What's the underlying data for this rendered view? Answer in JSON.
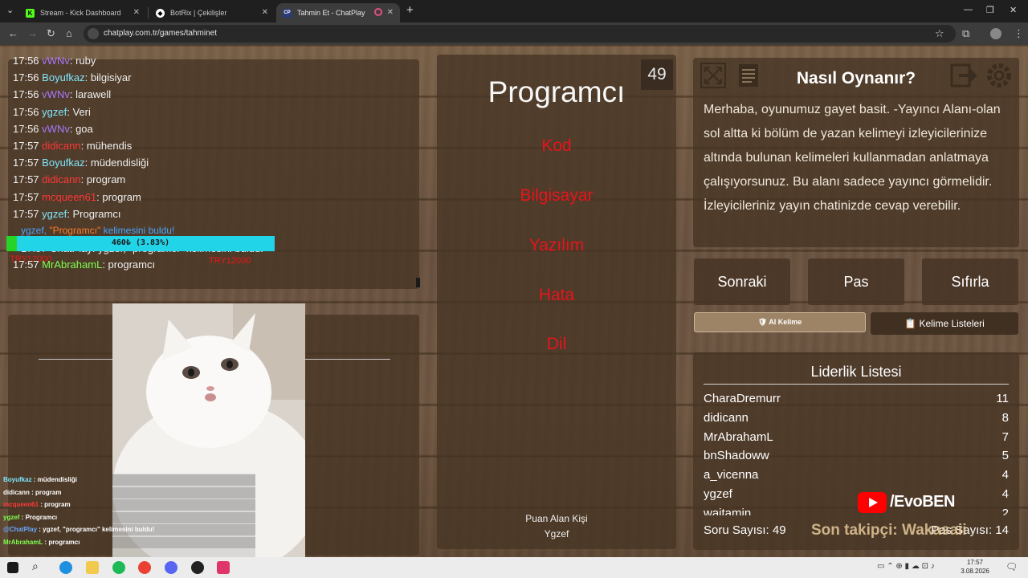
{
  "browser": {
    "tabs": [
      {
        "title": "Stream - Kick Dashboard",
        "icon": "kick-icon",
        "active": false
      },
      {
        "title": "BotRix | Çekilişler",
        "icon": "botrix-icon",
        "active": false
      },
      {
        "title": "Tahmin Et - ChatPlay",
        "icon": "chatplay-icon",
        "active": true
      }
    ],
    "url": "chatplay.com.tr/games/tahminet"
  },
  "chat": {
    "lines": [
      {
        "time": "17:56",
        "user": "vWNv",
        "color": "purple",
        "msg": "ruby"
      },
      {
        "time": "17:56",
        "user": "Boyufkaz",
        "color": "cyan",
        "msg": "bilgisiyar"
      },
      {
        "time": "17:56",
        "user": "vWNv",
        "color": "purple",
        "msg": "larawell"
      },
      {
        "time": "17:56",
        "user": "ygzef",
        "color": "cyan",
        "msg": "Veri"
      },
      {
        "time": "17:56",
        "user": "vWNv",
        "color": "purple",
        "msg": "goa"
      },
      {
        "time": "17:57",
        "user": "didicann",
        "color": "red",
        "msg": "mühendis"
      },
      {
        "time": "17:57",
        "user": "Boyufkaz",
        "color": "cyan",
        "msg": "müdendisliği"
      },
      {
        "time": "17:57",
        "user": "didicann",
        "color": "red",
        "msg": "program"
      },
      {
        "time": "17:57",
        "user": "mcqueen61",
        "color": "red",
        "msg": "program"
      },
      {
        "time": "17:57",
        "user": "ygzef",
        "color": "cyan",
        "msg": "Programcı"
      }
    ],
    "found_prefix": "ygzef, ",
    "found_word": "\"Programcı\"",
    "found_suffix": " kelimesini buldu!",
    "overlay_text": "17:57 ChatPlay: ygzef, \"programcı\" kelimesini buldu!",
    "last_line": {
      "time": "17:57",
      "user": "MrAbrahamL",
      "color": "green",
      "msg": "programcı"
    },
    "progress_text": "460₺ (3.83%)",
    "progress_percent": 3.83,
    "overlay_red_left": "TRY12000",
    "overlay_red_right": "TRY12000"
  },
  "mini_chat": [
    {
      "user": "Boyufkaz",
      "msg": "müdendisliği"
    },
    {
      "user": "didicann",
      "msg": "program"
    },
    {
      "user": "mcqueen61",
      "msg": "program"
    },
    {
      "user": "ygzef",
      "msg": "Programcı"
    },
    {
      "user": "@ChatPlay",
      "msg": "ygzef, \"programcı\" kelimesini buldu!"
    },
    {
      "user": "MrAbrahamL",
      "msg": "programcı"
    }
  ],
  "card": {
    "timer": "49",
    "word": "Programcı",
    "forbidden": [
      "Kod",
      "Bilgisayar",
      "Yazılım",
      "Hata",
      "Dil"
    ],
    "scorer_label": "Puan Alan Kişi",
    "scorer_name": "Ygzef"
  },
  "info": {
    "title": "Nasıl Oynanır?",
    "text": "Merhaba, oyunumuz gayet basit. -Yayıncı Alanı-olan sol altta ki bölüm de yazan kelimeyi izleyicilerinize altında bulunan kelimeleri kullanmadan anlatmaya çalışıyorsunuz. Bu alanı sadece yayıncı görmelidir. İzleyicileriniz yayın chatinizde cevap verebilir."
  },
  "buttons": {
    "next": "Sonraki",
    "pass": "Pas",
    "reset": "Sıfırla",
    "ai_word": "AI Kelime",
    "word_lists": "Kelime Listeleri"
  },
  "leaderboard": {
    "title": "Liderlik Listesi",
    "rows": [
      {
        "name": "CharaDremurr",
        "score": "11"
      },
      {
        "name": "didicann",
        "score": "8"
      },
      {
        "name": "MrAbrahamL",
        "score": "7"
      },
      {
        "name": "bnShadoww",
        "score": "5"
      },
      {
        "name": "a_vicenna",
        "score": "4"
      },
      {
        "name": "ygzef",
        "score": "4"
      },
      {
        "name": "waitamin",
        "score": "2"
      }
    ],
    "question_count_label": "Soru Sayısı:",
    "question_count": "49",
    "pass_count_label": "Pas Sayısı:",
    "pass_count": "14"
  },
  "overlay": {
    "yt_handle": "/EvoBEN",
    "last_follower": "Son takipçi: Wakasaii"
  },
  "taskbar": {
    "time": "17:57",
    "date": "3.08.2026"
  }
}
